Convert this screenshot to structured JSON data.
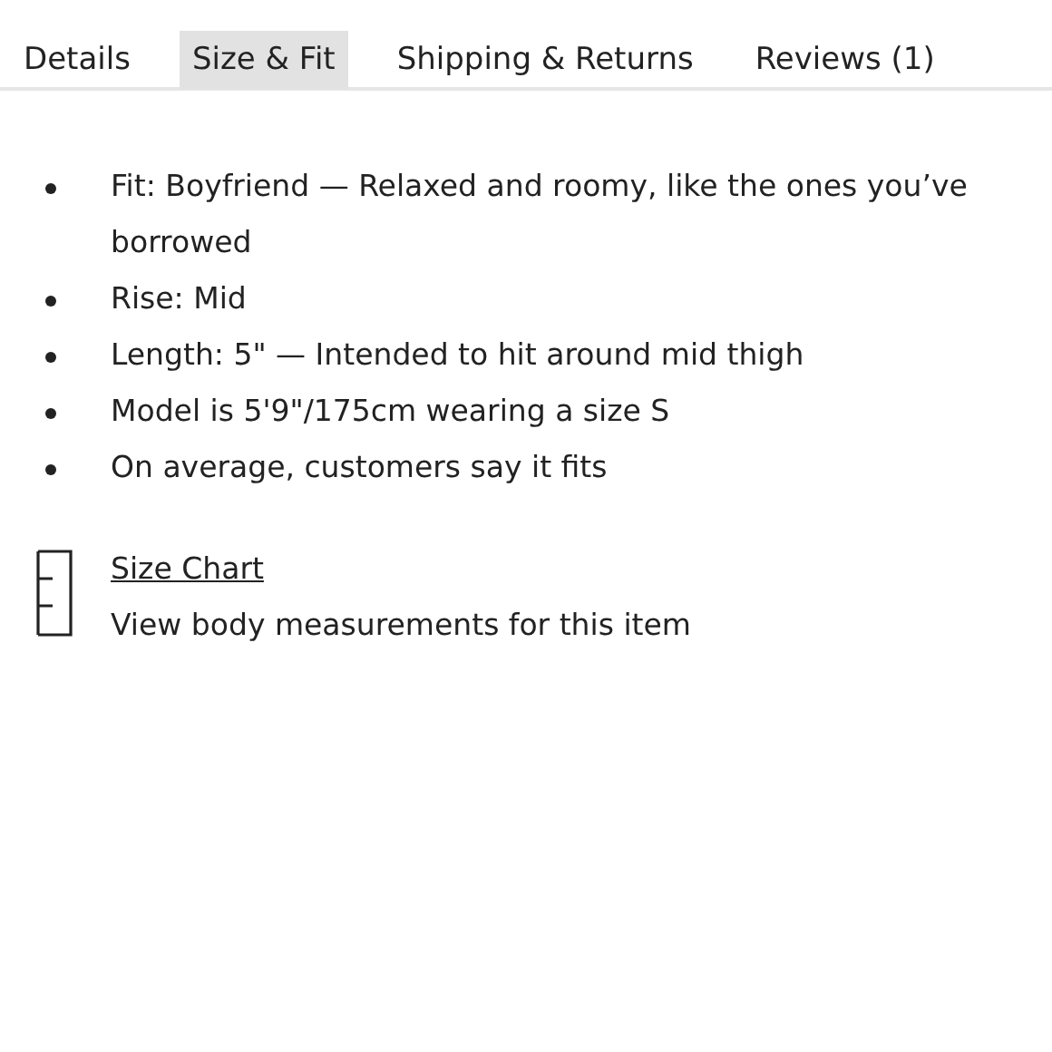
{
  "tabs": [
    {
      "label": "Details",
      "selected": false
    },
    {
      "label": "Size & Fit",
      "selected": true
    },
    {
      "label": "Shipping & Returns",
      "selected": false
    },
    {
      "label": "Reviews (1)",
      "selected": false
    }
  ],
  "fit_points": [
    "Fit: Boyfriend — Relaxed and roomy, like the ones you’ve borrowed",
    "Rise: Mid",
    "Length: 5\" — Intended to hit around mid thigh",
    "Model is 5'9\"/175cm wearing a size S",
    "On average, customers say it fits"
  ],
  "size_chart": {
    "link": "Size Chart",
    "description": "View body measurements for this item"
  }
}
